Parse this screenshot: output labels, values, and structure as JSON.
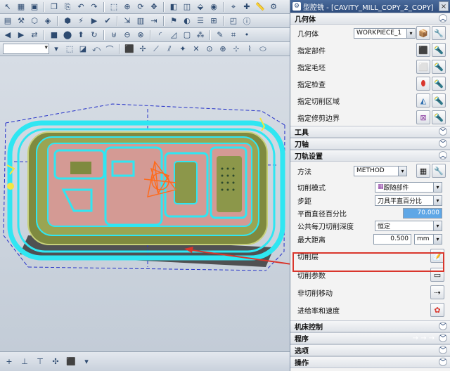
{
  "dialog": {
    "title": "型腔铣 - [CAVITY_MILL_COPY_2_COPY]",
    "close_glyph": "×",
    "bottom_arrows": "→ → →"
  },
  "geometry": {
    "header": "几何体",
    "geometry_label": "几何体",
    "geometry_value": "WORKPIECE_1",
    "specify_part": "指定部件",
    "specify_blank": "指定毛坯",
    "specify_check": "指定检查",
    "specify_cut_area": "指定切削区域",
    "specify_trim": "指定修剪边界"
  },
  "sections": {
    "tool": "工具",
    "tool_axis": "刀轴",
    "path_settings": "刀轨设置",
    "machine_control": "机床控制",
    "program": "程序",
    "options": "选项",
    "actions": "操作"
  },
  "path": {
    "method_label": "方法",
    "method_value": "METHOD",
    "cut_pattern_label": "切削模式",
    "cut_pattern_value": "跟随部件",
    "stepover_label": "步距",
    "stepover_value": "刀具平直百分比",
    "flat_diameter_label": "平面直径百分比",
    "flat_diameter_value": "70.000",
    "depth_label": "公共每刀切削深度",
    "depth_value": "恒定",
    "max_distance_label": "最大距离",
    "max_distance_value": "0.500",
    "max_distance_unit": "mm",
    "cut_levels_label": "切削层",
    "cut_params_label": "切削参数",
    "non_cut_moves_label": "非切削移动",
    "feeds_speeds_label": "进给率和速度"
  },
  "colors": {
    "title_bar": "#2f4d7d",
    "highlight": "#d9362c",
    "field_blue": "#5fa7e6",
    "toolpath_cyan": "#2fe6f2"
  }
}
